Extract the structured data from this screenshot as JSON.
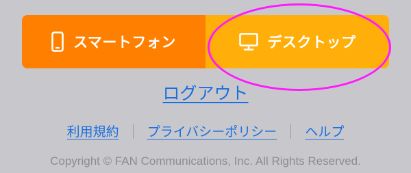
{
  "switcher": {
    "smartphone_label": "スマートフォン",
    "desktop_label": "デスクトップ",
    "smartphone_icon": "smartphone-icon",
    "desktop_icon": "desktop-monitor-icon",
    "colors": {
      "smartphone_bg": "#ff8000",
      "desktop_bg": "#ffae0a",
      "highlight": "#ff19ff"
    }
  },
  "logout_label": "ログアウト",
  "footer_links": [
    {
      "label": "利用規約"
    },
    {
      "label": "プライバシーポリシー"
    },
    {
      "label": "ヘルプ"
    }
  ],
  "copyright": "Copyright © FAN Communications, Inc. All Rights Reserved.",
  "colors": {
    "background": "#c8c8cc",
    "link": "#1a6fe0",
    "muted_text": "#8d8d91"
  }
}
